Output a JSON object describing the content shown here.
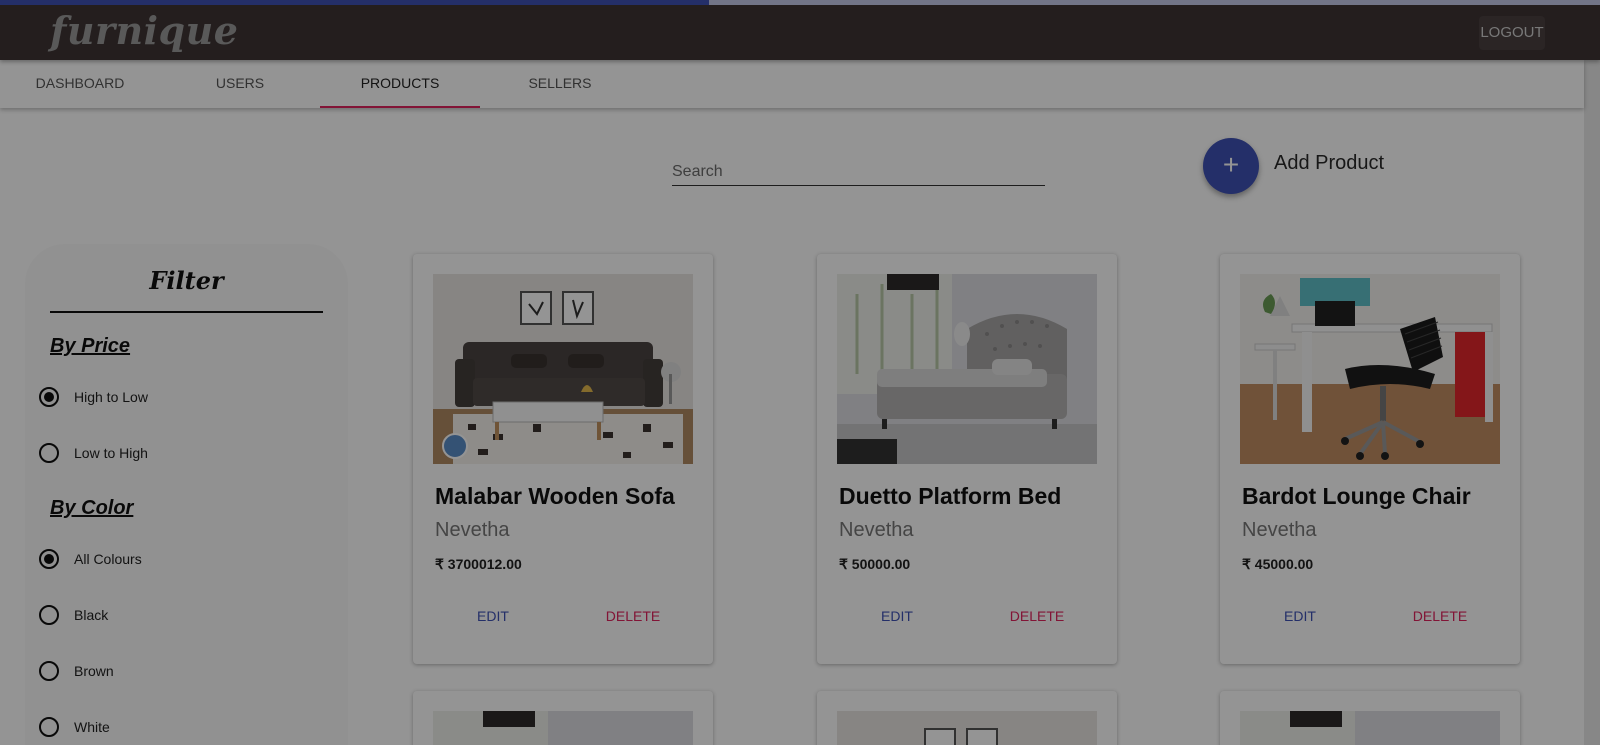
{
  "progress": {
    "value_percent": 44.3,
    "fill_color": "#3f51b5",
    "track_color": "#c5cae9"
  },
  "appbar": {
    "logo": "furnique",
    "logout_label": "LOGOUT",
    "background": "#3e3434"
  },
  "tabs": [
    {
      "label": "DASHBOARD",
      "active": false
    },
    {
      "label": "USERS",
      "active": false
    },
    {
      "label": "PRODUCTS",
      "active": true
    },
    {
      "label": "SELLERS",
      "active": false
    }
  ],
  "search": {
    "placeholder": "Search",
    "value": ""
  },
  "add_product": {
    "icon": "plus-icon",
    "label": "Add Product"
  },
  "filter": {
    "title": "Filter",
    "price": {
      "title": "By Price",
      "options": [
        "High to Low",
        "Low to High"
      ],
      "selected": "High to Low"
    },
    "color": {
      "title": "By Color",
      "options": [
        "All Colours",
        "Black",
        "Brown",
        "White"
      ],
      "selected": "All Colours"
    }
  },
  "products": [
    {
      "name": "Malabar Wooden Sofa",
      "seller": "Nevetha",
      "price": "₹ 3700012.00",
      "edit": "EDIT",
      "delete": "DELETE",
      "image": "sofa-photo"
    },
    {
      "name": "Duetto Platform Bed",
      "seller": "Nevetha",
      "price": "₹ 50000.00",
      "edit": "EDIT",
      "delete": "DELETE",
      "image": "bed-photo"
    },
    {
      "name": "Bardot Lounge Chair",
      "seller": "Nevetha",
      "price": "₹ 45000.00",
      "edit": "EDIT",
      "delete": "DELETE",
      "image": "chair-photo"
    }
  ],
  "accent_colors": {
    "primary": "#3f51b5",
    "danger": "#e0245e"
  },
  "overlay": {
    "visible": true
  }
}
